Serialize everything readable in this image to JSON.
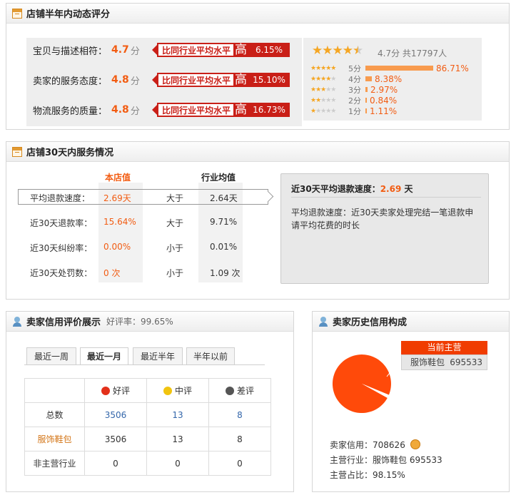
{
  "dsr": {
    "title": "店铺半年内动态评分",
    "rows": [
      {
        "label": "宝贝与描述相符：",
        "score": "4.7",
        "unit": "分",
        "compare": "比同行业平均水平",
        "level": "高",
        "pct": "6.15%"
      },
      {
        "label": "卖家的服务态度：",
        "score": "4.8",
        "unit": "分",
        "compare": "比同行业平均水平",
        "level": "高",
        "pct": "15.10%"
      },
      {
        "label": "物流服务的质量：",
        "score": "4.8",
        "unit": "分",
        "compare": "比同行业平均水平",
        "level": "高",
        "pct": "16.73%"
      }
    ],
    "rating": {
      "stars": "★★★★",
      "half": "★",
      "summary": "4.7分 共17797人",
      "dist": [
        {
          "stars_on": "★★★★★",
          "stars_off": "",
          "label": "5分",
          "bar": 0.8671,
          "pct": "86.71%"
        },
        {
          "stars_on": "★★★★",
          "stars_off": "★",
          "label": "4分",
          "bar": 0.0838,
          "pct": "8.38%"
        },
        {
          "stars_on": "★★★",
          "stars_off": "★★",
          "label": "3分",
          "bar": 0.0297,
          "pct": "2.97%"
        },
        {
          "stars_on": "★★",
          "stars_off": "★★★",
          "label": "2分",
          "bar": 0.0084,
          "pct": "0.84%"
        },
        {
          "stars_on": "★",
          "stars_off": "★★★★",
          "label": "1分",
          "bar": 0.0111,
          "pct": "1.11%"
        }
      ]
    }
  },
  "service": {
    "title": "店铺30天内服务情况",
    "col_shop": "本店值",
    "col_industry": "行业均值",
    "rows": [
      {
        "label": "平均退款速度：",
        "shop": "2.69天",
        "cmp": "大于",
        "industry": "2.64天"
      },
      {
        "label": "近30天退款率：",
        "shop": "15.64%",
        "cmp": "大于",
        "industry": "9.71%"
      },
      {
        "label": "近30天纠纷率：",
        "shop": "0.00%",
        "cmp": "小于",
        "industry": "0.01%"
      },
      {
        "label": "近30天处罚数：",
        "shop": "0 次",
        "cmp": "小于",
        "industry": "1.09 次"
      }
    ],
    "detail": {
      "heading": "近30天平均退款速度：",
      "value": "2.69",
      "unit": "天",
      "desc": "平均退款速度：近30天卖家处理完结一笔退款申请平均花费的时长"
    }
  },
  "credit": {
    "title": "卖家信用评价展示",
    "good_rate_label": "好评率：",
    "good_rate": "99.65%",
    "tabs": [
      "最近一周",
      "最近一月",
      "最近半年",
      "半年以前"
    ],
    "active_tab": 1,
    "headers": {
      "good": "好评",
      "mid": "中评",
      "bad": "差评"
    },
    "rows": [
      {
        "label": "总数",
        "good": "3506",
        "mid": "13",
        "bad": "8"
      },
      {
        "label": "服饰鞋包",
        "good": "3506",
        "mid": "13",
        "bad": "8"
      },
      {
        "label": "非主营行业",
        "good": "0",
        "mid": "0",
        "bad": "0"
      }
    ]
  },
  "history": {
    "title": "卖家历史信用构成",
    "pie_label": "当前主营",
    "category": "服饰鞋包",
    "category_value": "695533",
    "credit_label": "卖家信用：",
    "credit_value": "708626",
    "main_label": "主营行业：",
    "main_value": "服饰鞋包 695533",
    "ratio_label": "主营占比：",
    "ratio_value": "98.15%",
    "pie_share": 0.9815
  },
  "colors": {
    "accent": "#f25c12",
    "compare_red": "#c91f17",
    "pie": "#ff4a0a"
  }
}
